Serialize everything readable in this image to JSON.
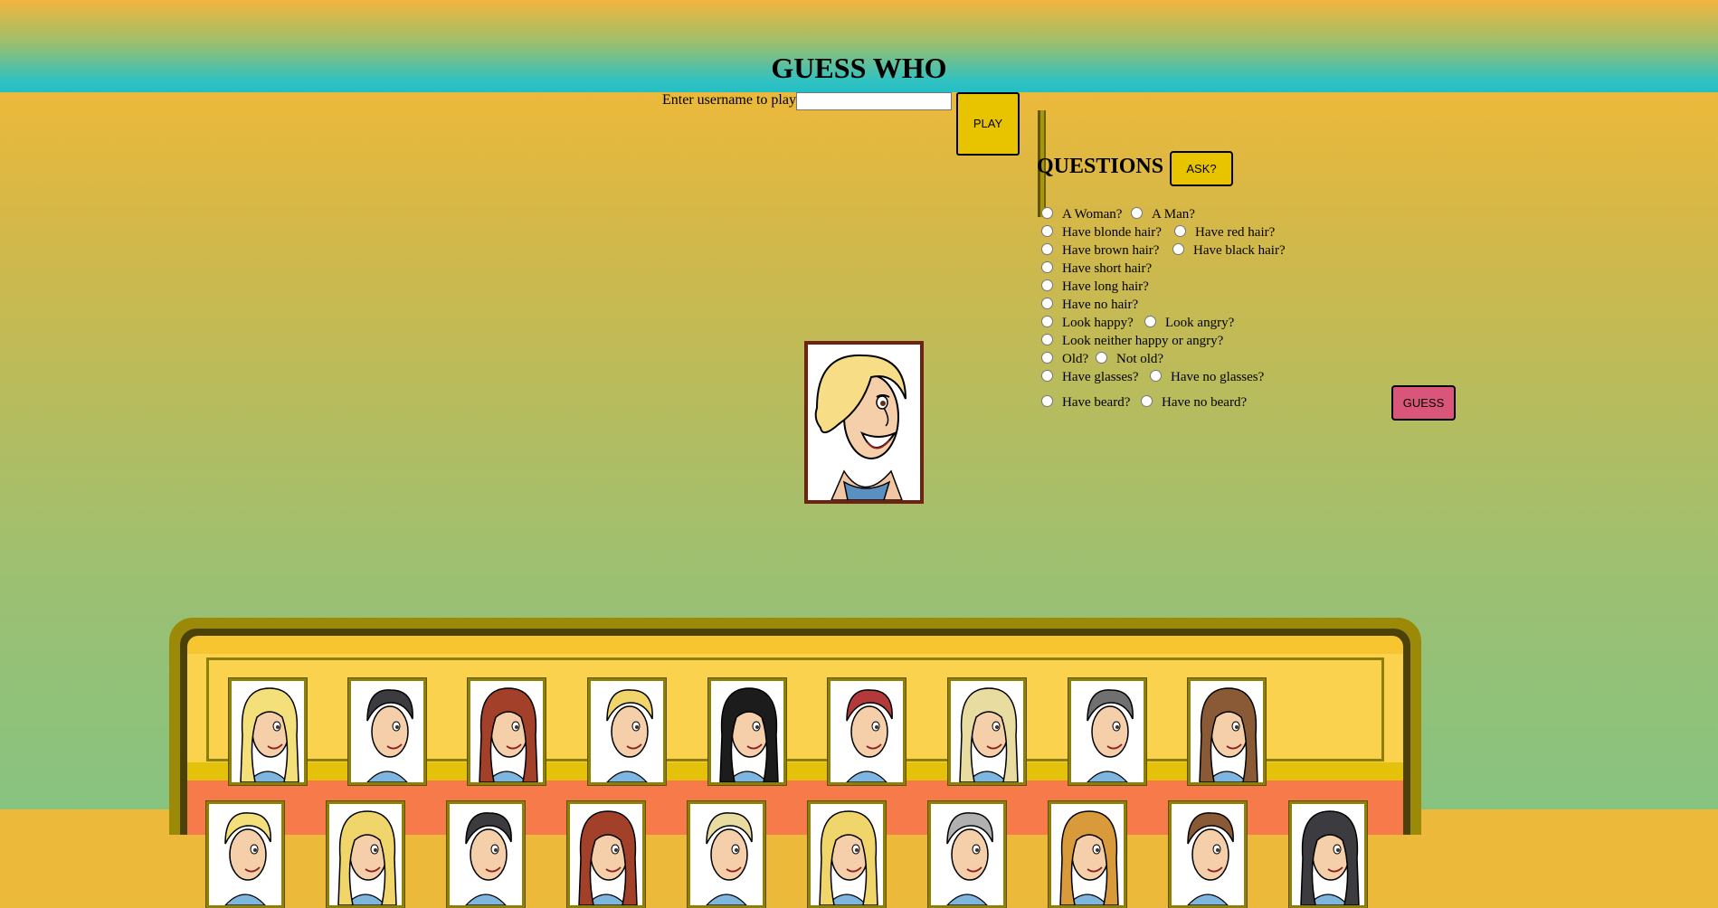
{
  "header": {
    "title": "GUESS WHO"
  },
  "login": {
    "label": "Enter username to play",
    "username_value": "",
    "play_label": "PLAY"
  },
  "questions": {
    "title": "QUESTIONS",
    "ask_label": "ASK?",
    "guess_label": "GUESS",
    "items": [
      "A Woman?",
      "A Man?",
      "Have blonde hair?",
      "Have red hair?",
      "Have brown hair?",
      "Have black hair?",
      "Have short hair?",
      "Have long hair?",
      "Have no hair?",
      "Look happy?",
      "Look angry?",
      "Look neither happy or angry?",
      "Old?",
      "Not old?",
      "Have glasses?",
      "Have no glasses?",
      "Have beard?",
      "Have no beard?"
    ]
  },
  "mystery_character": {
    "hair": "blonde",
    "label": ""
  },
  "colors": {
    "play": "#e7c300",
    "ask": "#e7c300",
    "guess": "#d9567a",
    "board_frame": "#9b8a08",
    "board_row1": "#fbd24e",
    "board_row2": "#f77a4a"
  },
  "board_row1_characters": [
    {
      "name": "blonde-long-hair-woman",
      "hair": "#f3e07a"
    },
    {
      "name": "black-hair-woman",
      "hair": "#3c3c40"
    },
    {
      "name": "red-hair-woman",
      "hair": "#a2402a"
    },
    {
      "name": "blonde-glasses-woman",
      "hair": "#f0d66a"
    },
    {
      "name": "black-quiff-man",
      "hair": "#1c1c1c"
    },
    {
      "name": "red-spiky-hair-woman",
      "hair": "#b23a3a"
    },
    {
      "name": "blonde-spiky-man",
      "hair": "#e9dca0"
    },
    {
      "name": "grey-hair-man",
      "hair": "#707070"
    },
    {
      "name": "brown-hair-man",
      "hair": "#8a5a36"
    }
  ],
  "board_row2_count": 10
}
